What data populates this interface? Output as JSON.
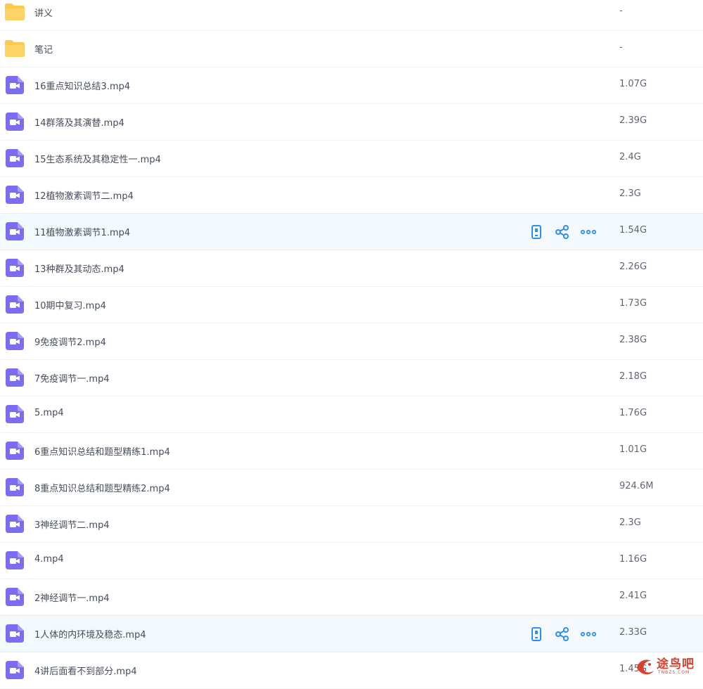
{
  "files": [
    {
      "type": "folder",
      "name": "讲义",
      "size": "-"
    },
    {
      "type": "folder",
      "name": "笔记",
      "size": "-"
    },
    {
      "type": "video",
      "name": "16重点知识总结3.mp4",
      "size": "1.07G"
    },
    {
      "type": "video",
      "name": "14群落及其演替.mp4",
      "size": "2.39G"
    },
    {
      "type": "video",
      "name": "15生态系统及其稳定性一.mp4",
      "size": "2.4G"
    },
    {
      "type": "video",
      "name": "12植物激素调节二.mp4",
      "size": "2.3G"
    },
    {
      "type": "video",
      "name": "11植物激素调节1.mp4",
      "size": "1.54G",
      "hover": true
    },
    {
      "type": "video",
      "name": "13种群及其动态.mp4",
      "size": "2.26G"
    },
    {
      "type": "video",
      "name": "10期中复习.mp4",
      "size": "1.73G"
    },
    {
      "type": "video",
      "name": "9免疫调节2.mp4",
      "size": "2.38G"
    },
    {
      "type": "video",
      "name": "7免疫调节一.mp4",
      "size": "2.18G"
    },
    {
      "type": "video",
      "name": "5.mp4",
      "size": "1.76G"
    },
    {
      "type": "video",
      "name": "6重点知识总结和题型精练1.mp4",
      "size": "1.01G"
    },
    {
      "type": "video",
      "name": "8重点知识总结和题型精练2.mp4",
      "size": "924.6M"
    },
    {
      "type": "video",
      "name": "3神经调节二.mp4",
      "size": "2.3G"
    },
    {
      "type": "video",
      "name": "4.mp4",
      "size": "1.16G"
    },
    {
      "type": "video",
      "name": "2神经调节一.mp4",
      "size": "2.41G"
    },
    {
      "type": "video",
      "name": "1人体的内环境及稳态.mp4",
      "size": "2.33G",
      "hover": true
    },
    {
      "type": "video",
      "name": "4讲后面看不到部分.mp4",
      "size": "1.45G"
    }
  ],
  "row_actions": [
    {
      "icon": "phone-icon"
    },
    {
      "icon": "share-icon"
    },
    {
      "icon": "more-icon"
    }
  ],
  "colors": {
    "folder": "#ffc94d",
    "video": "#7b6cf0",
    "action": "#2f8ff0",
    "hover_bg": "#f4f9fe"
  },
  "watermark": {
    "text": "途鸟吧",
    "sub": "TNBZS.COM"
  }
}
